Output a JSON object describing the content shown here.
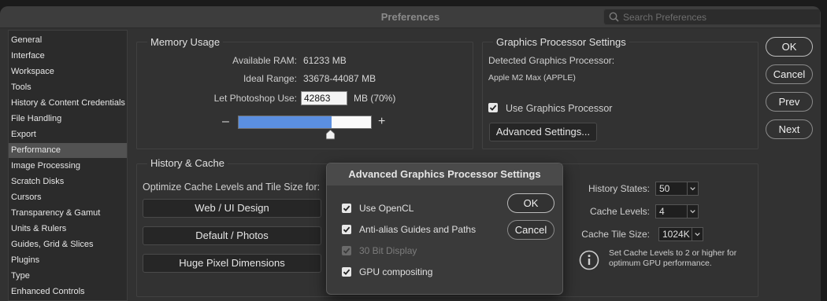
{
  "window": {
    "title": "Preferences"
  },
  "search": {
    "placeholder": "Search Preferences"
  },
  "sidebar": {
    "items": [
      {
        "label": "General"
      },
      {
        "label": "Interface"
      },
      {
        "label": "Workspace"
      },
      {
        "label": "Tools"
      },
      {
        "label": "History & Content Credentials"
      },
      {
        "label": "File Handling"
      },
      {
        "label": "Export"
      },
      {
        "label": "Performance",
        "active": true
      },
      {
        "label": "Image Processing"
      },
      {
        "label": "Scratch Disks"
      },
      {
        "label": "Cursors"
      },
      {
        "label": "Transparency & Gamut"
      },
      {
        "label": "Units & Rulers"
      },
      {
        "label": "Guides, Grid & Slices"
      },
      {
        "label": "Plugins"
      },
      {
        "label": "Type"
      },
      {
        "label": "Enhanced Controls"
      }
    ]
  },
  "memory": {
    "title": "Memory Usage",
    "available_label": "Available RAM:",
    "available_value": "61233 MB",
    "ideal_label": "Ideal Range:",
    "ideal_value": "33678-44087 MB",
    "let_use_label": "Let Photoshop Use:",
    "let_use_value": "42863",
    "let_use_unit": "MB (70%)",
    "slider_fraction": 0.7,
    "minus": "–",
    "plus": "+"
  },
  "gpu": {
    "title": "Graphics Processor Settings",
    "detected_label": "Detected Graphics Processor:",
    "detected_value": "Apple M2 Max (APPLE)",
    "use_gpu_label": "Use Graphics Processor",
    "use_gpu_checked": true,
    "advanced_button": "Advanced Settings..."
  },
  "history_cache": {
    "title": "History & Cache",
    "optimize_label": "Optimize Cache Levels and Tile Size for:",
    "buttons": [
      "Web / UI Design",
      "Default / Photos",
      "Huge Pixel Dimensions"
    ],
    "history_states_label": "History States:",
    "history_states_value": "50",
    "cache_levels_label": "Cache Levels:",
    "cache_levels_value": "4",
    "cache_tile_label": "Cache Tile Size:",
    "cache_tile_value": "1024K",
    "note": "Set Cache Levels to 2 or higher for optimum GPU performance."
  },
  "actions": {
    "ok": "OK",
    "cancel": "Cancel",
    "prev": "Prev",
    "next": "Next"
  },
  "modal": {
    "title": "Advanced Graphics Processor Settings",
    "options": [
      {
        "label": "Use OpenCL",
        "checked": true,
        "disabled": false
      },
      {
        "label": "Anti-alias Guides and Paths",
        "checked": true,
        "disabled": false
      },
      {
        "label": "30 Bit Display",
        "checked": true,
        "disabled": true
      },
      {
        "label": "GPU compositing",
        "checked": true,
        "disabled": false
      }
    ],
    "ok": "OK",
    "cancel": "Cancel"
  },
  "colors": {
    "accent": "#5b8fe0",
    "panel": "#323232",
    "sidebar_active": "#525252"
  }
}
